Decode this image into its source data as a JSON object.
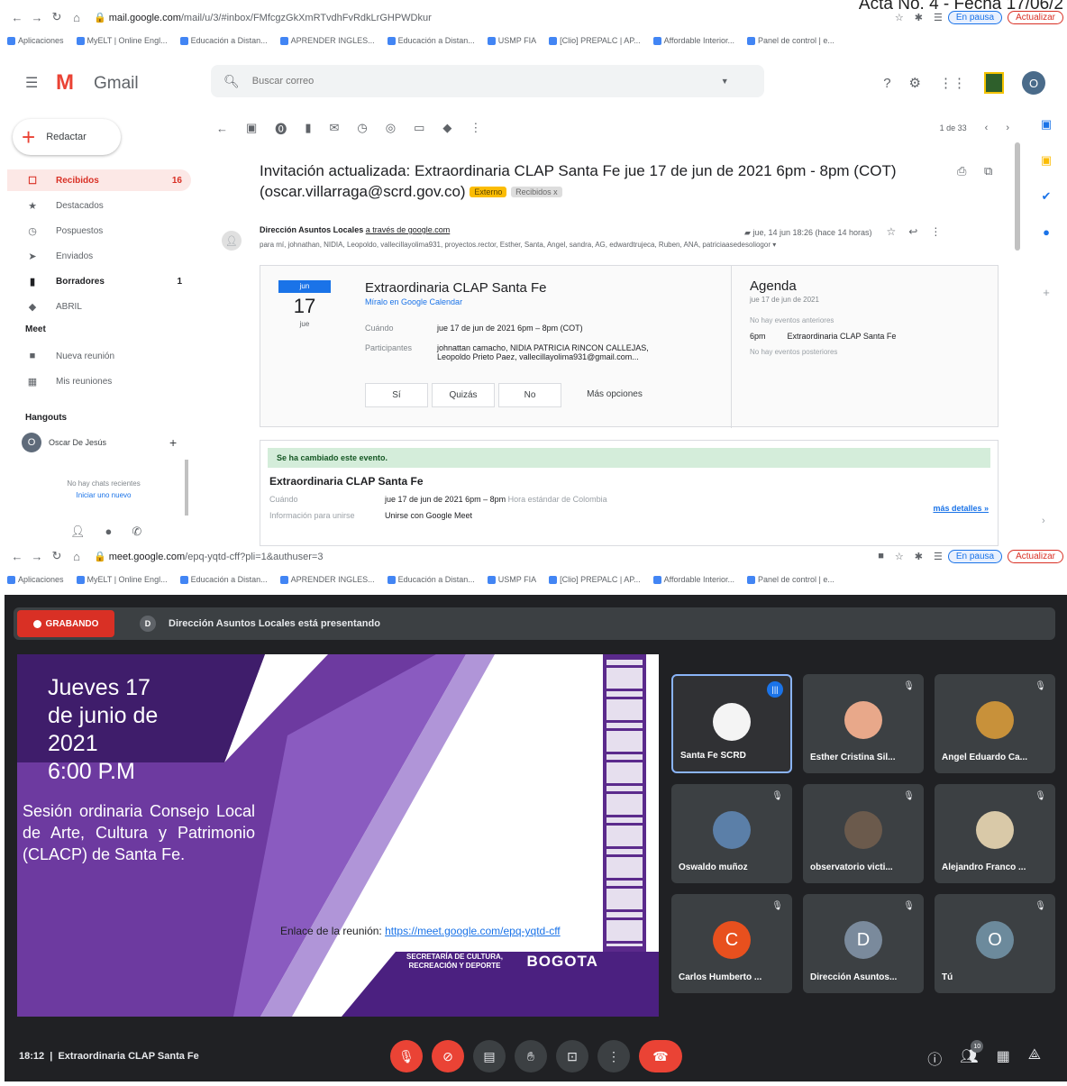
{
  "header_text": "Acta No. 4 - Fecha 17/06/2",
  "browser_top": {
    "url_host": "mail.google.com",
    "url_path": "/mail/u/3/#inbox/FMfcgzGkXmRTvdhFvRdkLrGHPWDkur",
    "profile_label": "En pausa",
    "update_label": "Actualizar"
  },
  "bookmarks": [
    "Aplicaciones",
    "MyELT | Online Engl...",
    "Educación a Distan...",
    "APRENDER INGLES...",
    "Educación a Distan...",
    "USMP FIA",
    "[Clio] PREPALC | AP...",
    "Affordable Interior...",
    "Panel de control | e..."
  ],
  "gmail": {
    "app_name": "Gmail",
    "search_placeholder": "Buscar correo",
    "compose_label": "Redactar",
    "nav": [
      {
        "label": "Recibidos",
        "count": "16",
        "icon": "inbox-icon"
      },
      {
        "label": "Destacados",
        "count": "",
        "icon": "star-icon"
      },
      {
        "label": "Pospuestos",
        "count": "",
        "icon": "clock-icon"
      },
      {
        "label": "Enviados",
        "count": "",
        "icon": "send-icon"
      },
      {
        "label": "Borradores",
        "count": "1",
        "icon": "draft-icon"
      },
      {
        "label": "ABRIL",
        "count": "",
        "icon": "label-icon"
      }
    ],
    "meet_section": "Meet",
    "meet_items": [
      "Nueva reunión",
      "Mis reuniones"
    ],
    "hangouts_section": "Hangouts",
    "hangouts_user": "Oscar De Jesús",
    "hangouts_initial": "O",
    "no_chats": "No hay chats recientes",
    "start_new": "Iniciar uno nuevo",
    "pager": "1 de 33",
    "avatar_initial": "O",
    "subject": "Invitación actualizada: Extraordinaria CLAP Santa Fe jue 17 de jun de 2021 6pm - 8pm (COT) (oscar.villarraga@scrd.gov.co)",
    "tag_external": "Externo",
    "tag_inbox": "Recibidos x",
    "sender_name": "Dirección Asuntos Locales",
    "sender_via": "a través de google.com",
    "sent_time": "jue, 14 jun 18:26 (hace 14 horas)",
    "recipients": "para mí, johnathan, NIDIA, Leopoldo, vallecillayolima931, proyectos.rector, Esther, Santa, Angel, sandra, AG, edwardtrujeca, Ruben, ANA, patriciaasedesoliogor",
    "invite": {
      "cal_month": "jun",
      "cal_day": "17",
      "cal_weekday": "jue",
      "title": "Extraordinaria CLAP Santa Fe",
      "view_link": "Míralo en Google Calendar",
      "when_label": "Cuándo",
      "when_value": "jue 17 de jun de 2021 6pm – 8pm (COT)",
      "guests_label": "Participantes",
      "guests_value_1": "johnattan camacho, NIDIA PATRICIA RINCON CALLEJAS,",
      "guests_value_2": "Leopoldo Prieto Paez, vallecillayolima931@gmail.com...",
      "rsvp": [
        "Sí",
        "Quizás",
        "No",
        "Más opciones"
      ]
    },
    "agenda": {
      "title": "Agenda",
      "date": "jue 17 de jun de 2021",
      "no_before": "No hay eventos anteriores",
      "time": "6pm",
      "event": "Extraordinaria CLAP Santa Fe",
      "no_after": "No hay eventos posteriores"
    },
    "changed": {
      "banner": "Se ha cambiado este evento.",
      "title": "Extraordinaria CLAP Santa Fe",
      "when_label": "Cuándo",
      "when_value": "jue 17 de jun de 2021 6pm – 8pm",
      "when_tz": "Hora estándar de Colombia",
      "join_label": "Información para unirse",
      "join_value": "Unirse con Google Meet",
      "more": "más detalles »"
    }
  },
  "browser_bottom": {
    "url_host": "meet.google.com",
    "url_path": "/epq-yqtd-cff?pli=1&authuser=3",
    "profile_label": "En pausa",
    "update_label": "Actualizar"
  },
  "meet": {
    "recording": "GRABANDO",
    "presenter_initial": "D",
    "presenting": "Dirección Asuntos Locales está presentando",
    "slide": {
      "date_lines": [
        "Jueves 17",
        "de junio de",
        "2021",
        "6:00 P.M"
      ],
      "description": "Sesión ordinaria Consejo Local de Arte, Cultura y Patrimonio (CLACP) de Santa Fe.",
      "link_label": "Enlace de la reunión:",
      "link_url": "https://meet.google.com/epq-yqtd-cff",
      "secretaria": "SECRETARÍA DE CULTURA, RECREACIÓN Y DEPORTE",
      "bogota": "BOGOTA"
    },
    "participants": [
      {
        "name": "Santa Fe SCRD",
        "type": "photo",
        "color": "#f4f4f4",
        "speaking": true
      },
      {
        "name": "Esther Cristina Sil...",
        "type": "photo",
        "color": "#e8a88a",
        "speaking": false
      },
      {
        "name": "Angel Eduardo Ca...",
        "type": "photo",
        "color": "#c8913a",
        "speaking": false
      },
      {
        "name": "Oswaldo muñoz",
        "type": "photo",
        "color": "#5b7fa8",
        "speaking": false
      },
      {
        "name": "observatorio victi...",
        "type": "photo",
        "color": "#6b5a4c",
        "speaking": false
      },
      {
        "name": "Alejandro Franco ...",
        "type": "photo",
        "color": "#d9c9a8",
        "speaking": false
      },
      {
        "name": "Carlos Humberto ...",
        "type": "initial",
        "initial": "C",
        "color": "#e8501e",
        "speaking": false
      },
      {
        "name": "Dirección Asuntos...",
        "type": "initial",
        "initial": "D",
        "color": "#7a8a9c",
        "speaking": false
      },
      {
        "name": "Tú",
        "type": "initial",
        "initial": "O",
        "color": "#6c8a9c",
        "speaking": false
      }
    ],
    "meeting_time": "18:12",
    "meeting_name": "Extraordinaria CLAP Santa Fe",
    "people_count": "10"
  }
}
